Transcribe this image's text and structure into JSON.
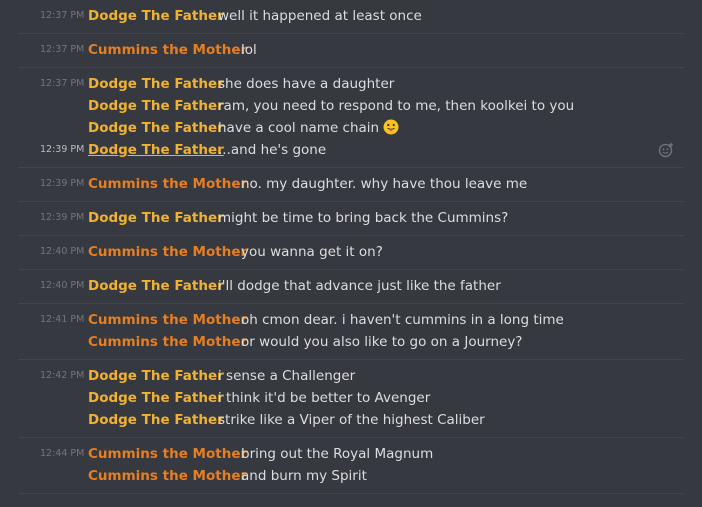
{
  "colors": {
    "background": "#36393f",
    "dodge": "#f0b232",
    "cummins": "#e67e22",
    "text": "#dcddde",
    "timestamp": "#72767d"
  },
  "groups": [
    {
      "messages": [
        {
          "time": "12:37 PM",
          "author": "Dodge The Father",
          "role": "dodge",
          "text": "well it happened at least once"
        }
      ]
    },
    {
      "messages": [
        {
          "time": "12:37 PM",
          "author": "Cummins the Mother",
          "role": "cummins",
          "text": "lol"
        }
      ]
    },
    {
      "messages": [
        {
          "time": "12:37 PM",
          "author": "Dodge The Father",
          "role": "dodge",
          "text": "she does have a daughter"
        },
        {
          "time": "",
          "author": "Dodge The Father",
          "role": "dodge",
          "text": "ram, you need to respond to me, then koolkei to you"
        },
        {
          "time": "",
          "author": "Dodge The Father",
          "role": "dodge",
          "text": "have a cool name chain",
          "emoji": "tongue-face-emoji"
        },
        {
          "time": "12:39 PM",
          "author": "Dodge The Father",
          "role": "dodge",
          "text": "...and he's gone",
          "hover": true
        }
      ]
    },
    {
      "messages": [
        {
          "time": "12:39 PM",
          "author": "Cummins the Mother",
          "role": "cummins",
          "text": "no. my daughter. why have thou leave me"
        }
      ]
    },
    {
      "messages": [
        {
          "time": "12:39 PM",
          "author": "Dodge The Father",
          "role": "dodge",
          "text": "might be time to bring back the Cummins?"
        }
      ]
    },
    {
      "messages": [
        {
          "time": "12:40 PM",
          "author": "Cummins the Mother",
          "role": "cummins",
          "text": "you wanna get it on?"
        }
      ]
    },
    {
      "messages": [
        {
          "time": "12:40 PM",
          "author": "Dodge The Father",
          "role": "dodge",
          "text": "i'll dodge that advance just like the father"
        }
      ]
    },
    {
      "messages": [
        {
          "time": "12:41 PM",
          "author": "Cummins the Mother",
          "role": "cummins",
          "text": "oh cmon dear. i haven't cummins in a long time"
        },
        {
          "time": "",
          "author": "Cummins the Mother",
          "role": "cummins",
          "text": "or would you also like to go on a Journey?"
        }
      ]
    },
    {
      "messages": [
        {
          "time": "12:42 PM",
          "author": "Dodge The Father",
          "role": "dodge",
          "text": "i sense a Challenger"
        },
        {
          "time": "",
          "author": "Dodge The Father",
          "role": "dodge",
          "text": "i think it'd be better to Avenger"
        },
        {
          "time": "",
          "author": "Dodge The Father",
          "role": "dodge",
          "text": "strike like a Viper of the highest Caliber"
        }
      ]
    },
    {
      "messages": [
        {
          "time": "12:44 PM",
          "author": "Cummins the Mother",
          "role": "cummins",
          "text": "bring out the Royal Magnum"
        },
        {
          "time": "",
          "author": "Cummins the Mother",
          "role": "cummins",
          "text": "and burn my Spirit"
        }
      ]
    }
  ],
  "icons": {
    "reaction": "add-reaction-icon"
  }
}
